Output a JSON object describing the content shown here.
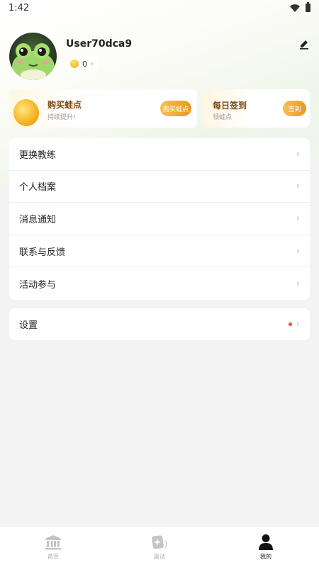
{
  "status": {
    "time": "1:42"
  },
  "profile": {
    "username": "User70dca9",
    "coins": "0"
  },
  "cards": {
    "buy": {
      "title": "购买蛙点",
      "subtitle": "持续提升!",
      "button": "购买蛙点"
    },
    "sign": {
      "title": "每日签到",
      "subtitle": "领蛙点",
      "button": "签到"
    }
  },
  "menu": {
    "items": [
      {
        "label": "更换教练"
      },
      {
        "label": "个人档案"
      },
      {
        "label": "消息通知"
      },
      {
        "label": "联系与反馈"
      },
      {
        "label": "活动参与"
      }
    ],
    "settings": {
      "label": "设置"
    }
  },
  "tabs": [
    {
      "label": "首页",
      "icon": "bank-icon"
    },
    {
      "label": "面试",
      "icon": "star-card-icon"
    },
    {
      "label": "我的",
      "icon": "user-icon"
    }
  ],
  "colors": {
    "accent": "#e89a21",
    "card_title": "#7a4a12",
    "notice_dot": "#e84a3a"
  }
}
